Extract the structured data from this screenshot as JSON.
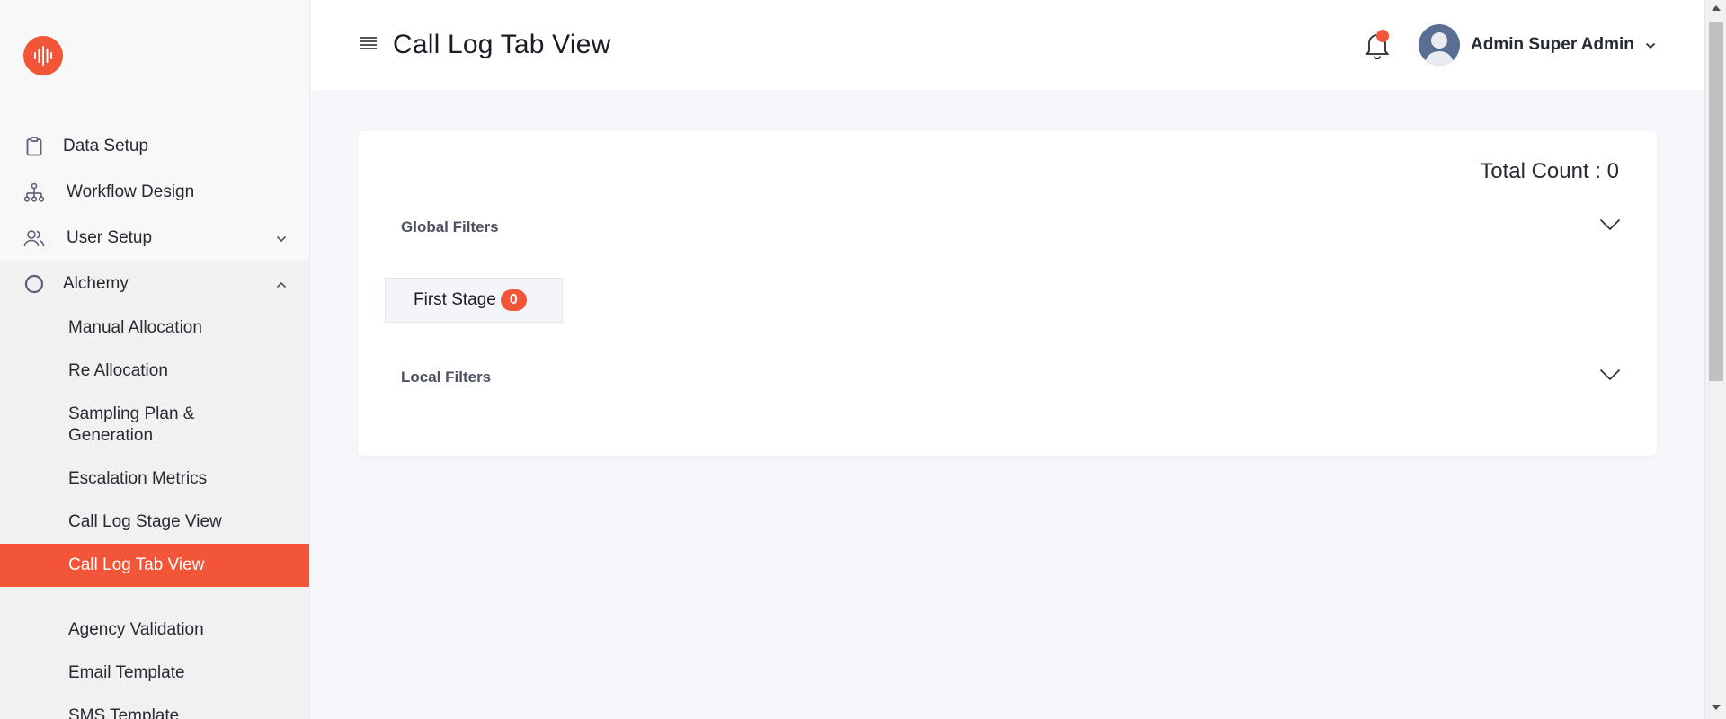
{
  "sidebar": {
    "menu": [
      {
        "label": "Data Setup",
        "icon": "clipboard-icon"
      },
      {
        "label": "Workflow Design",
        "icon": "hierarchy-icon"
      },
      {
        "label": "User Setup",
        "icon": "users-icon"
      },
      {
        "label": "Alchemy",
        "icon": "circle-icon"
      }
    ],
    "alchemy_items": [
      {
        "label": "Manual Allocation"
      },
      {
        "label": "Re Allocation"
      },
      {
        "label": "Sampling Plan & Generation"
      },
      {
        "label": "Escalation Metrics"
      },
      {
        "label": "Call Log Stage View"
      },
      {
        "label": "Call Log Tab View"
      },
      {
        "label": "Agency Validation"
      },
      {
        "label": "Email Template"
      },
      {
        "label": "SMS Template"
      }
    ]
  },
  "header": {
    "title": "Call Log Tab View",
    "user_name": "Admin Super Admin"
  },
  "main": {
    "total_count_label": "Total Count : 0",
    "global_filters_label": "Global Filters",
    "local_filters_label": "Local Filters",
    "stage_tab": {
      "label": "First Stage",
      "count": "0"
    }
  },
  "colors": {
    "accent": "#f25537",
    "sidebar_bg": "#f8f8f8",
    "content_bg": "#f4f6fa"
  }
}
